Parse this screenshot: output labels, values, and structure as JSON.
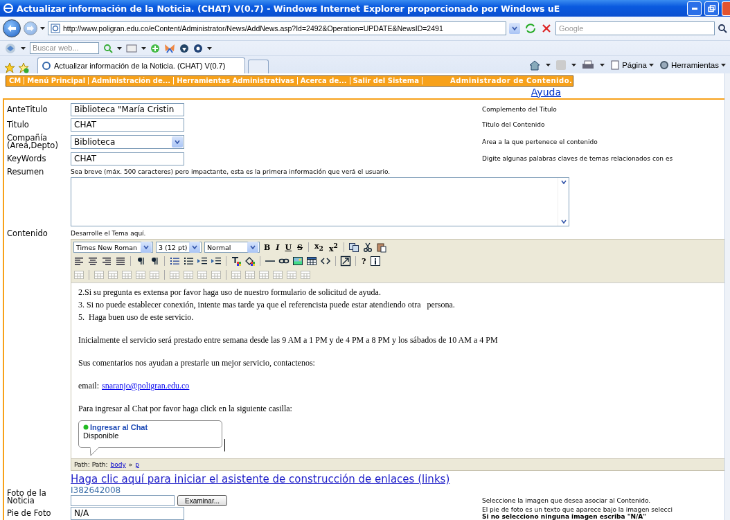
{
  "window": {
    "title": "Actualizar información de la Noticia. (CHAT) V(0.7) - Windows Internet Explorer proporcionado por Windows uE"
  },
  "address_bar": {
    "url": "http://www.poligran.edu.co/eContent/Administrator/News/AddNews.asp?Id=2492&Operation=UPDATE&NewsID=2491",
    "search_placeholder": "Google"
  },
  "search_toolbar": {
    "placeholder": "Buscar web..."
  },
  "tabs": [
    {
      "label": "Actualizar información de la Noticia. (CHAT) V(0.7)",
      "selected": true
    }
  ],
  "command_bar": [
    "Página",
    "Herramientas"
  ],
  "site_menu": {
    "items": [
      "CM",
      "Menú Principal",
      "Administración de...",
      "Herramientas Administrativas",
      "Acerca de...",
      "Salir del Sistema"
    ],
    "title": "Administrador de Contenido."
  },
  "help_link": "Ayuda",
  "fields": [
    {
      "kind": "text",
      "label": "AnteTitulo",
      "value": "Biblioteca \"María Cristin",
      "hint": "Complemento del Titulo"
    },
    {
      "kind": "text",
      "label": "Titulo",
      "value": "CHAT",
      "hint": "Titulo del Contenido"
    },
    {
      "kind": "select",
      "label": "Compañía (Area,Depto)",
      "value": "Biblioteca",
      "hint": "Area a la que pertenece el contenido"
    },
    {
      "kind": "text",
      "label": "KeyWords",
      "value": "CHAT",
      "hint": "Digite algunas palabras claves de temas relacionados con es"
    },
    {
      "kind": "textarea",
      "label": "Resumen",
      "note": "Sea breve (máx. 500 caracteres) pero impactante, esta es la primera información que verá el usuario."
    }
  ],
  "editor": {
    "label": "Contenido",
    "note": "Desarrolle el Tema aquí.",
    "font": "Times New Roman",
    "size": "3 (12 pt)",
    "format": "Normal",
    "format_buttons": [
      "B",
      "I",
      "U",
      "S"
    ],
    "script_buttons": [
      "x$_{2}$",
      "x$^{2}$"
    ],
    "help_button": "?",
    "blocks": [
      {
        "kind": "lines",
        "lines": [
          "2.Si su pregunta es extensa por favor haga uso de nuestro formulario de solicitud de ayuda.",
          "3. Si no puede establecer conexión, intente mas tarde ya que el referencista puede estar atendiendo otra   persona.",
          "5.  Haga buen uso de este servicio."
        ]
      },
      {
        "kind": "para",
        "text": "Inicialmente el servicio será prestado entre semana desde las 9 AM a 1 PM y de 4 PM a 8 PM y los sábados de 10 AM a 4 PM"
      },
      {
        "kind": "para",
        "text": "Sus comentarios nos ayudan a prestarle un mejor servicio, contactenos:"
      },
      {
        "kind": "email",
        "label": "email:",
        "email": "snaranjo@poligran.edu.co"
      },
      {
        "kind": "para",
        "text": "Para ingresar al Chat por favor haga click en la siguiente casilla:"
      },
      {
        "kind": "chat",
        "link": "Ingresar al Chat",
        "status": "Disponible"
      }
    ],
    "path_label": "Path: Path:",
    "path": [
      "body",
      "p"
    ],
    "path_separator": "»"
  },
  "links_wizard": "Haga clic aquí para iniciar el asistente de construcción de enlaces (links)",
  "photo": {
    "label": "Foto de la Noticia",
    "filename": "I382642008",
    "button": "Examinar...",
    "hint": "Seleccione la imagen que desea asociar al Contenido."
  },
  "caption": {
    "label": "Pie de Foto",
    "value": "N/A",
    "hint": "El pie de foto es un texto que aparece bajo la imagen selecci",
    "hint_bold": "Si no selecciono ninguna imagen escriba \"N/A\""
  }
}
